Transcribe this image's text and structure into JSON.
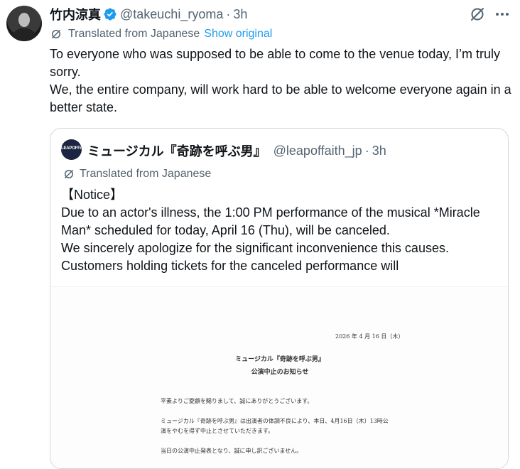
{
  "tweet": {
    "display_name": "竹内涼真",
    "handle": "@takeuchi_ryoma",
    "separator": "·",
    "time": "3h",
    "translated_label": "Translated from Japanese",
    "show_original": "Show original",
    "lines": [
      "To everyone who was supposed to be able to come to the venue today, I’m truly sorry.",
      "We, the entire company, will work hard to be able to welcome everyone again in a better state."
    ]
  },
  "quote": {
    "avatar_text": "LEAPOFFAITH",
    "display_name": "ミュージカル『奇跡を呼ぶ男』",
    "handle": "@leapoffaith_jp",
    "separator": "·",
    "time": "3h",
    "translated_label": "Translated from Japanese",
    "lines": [
      "【Notice】",
      "Due to an actor's illness, the 1:00 PM performance of the musical *Miracle Man* scheduled for today, April 16 (Thu), will be canceled.",
      "We sincerely apologize for the significant inconvenience this causes.",
      "Customers holding tickets for the canceled performance will"
    ],
    "document": {
      "date": "2026 年 4 月 16 日（木）",
      "title_1": "ミュージカル『奇跡を呼ぶ男』",
      "title_2": "公演中止のお知らせ",
      "para_1": "平素よりご愛顧を賜りまして、誠にありがとうございます。",
      "para_2a": "ミュージカル『奇跡を呼ぶ男』は出演者の体調不良により、本日、4月16日（木）13時公",
      "para_2b": "演をやむを得ず中止とさせていただきます。",
      "para_3": "当日の公演中止発表となり、誠に申し訳ございません。"
    }
  },
  "colors": {
    "text": "#0f1419",
    "secondary": "#536471",
    "accent": "#1d9bf0",
    "border": "#cfd9de"
  },
  "icons": [
    "verified-badge-icon",
    "grok-icon",
    "more-icon",
    "translate-icon"
  ]
}
